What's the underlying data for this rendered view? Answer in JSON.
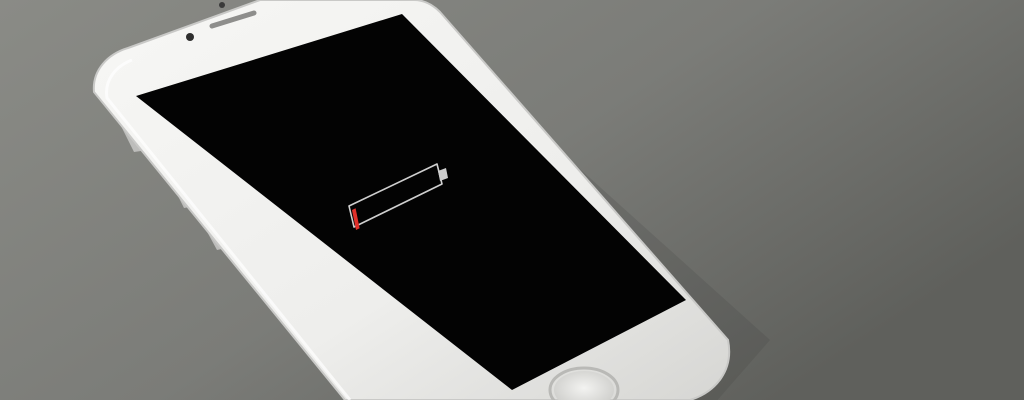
{
  "scene": {
    "subject": "smartphone",
    "colors": {
      "table_light": "#8a8b86",
      "table_mid": "#7b7c78",
      "table_dark": "#5f605c",
      "phone_body": "#eeeeec",
      "phone_edge": "#c9c9c7",
      "screen": "#030303",
      "battery_outline": "#cfcfcf",
      "battery_level": "#e0302a"
    },
    "battery": {
      "level_percent": 5
    }
  }
}
